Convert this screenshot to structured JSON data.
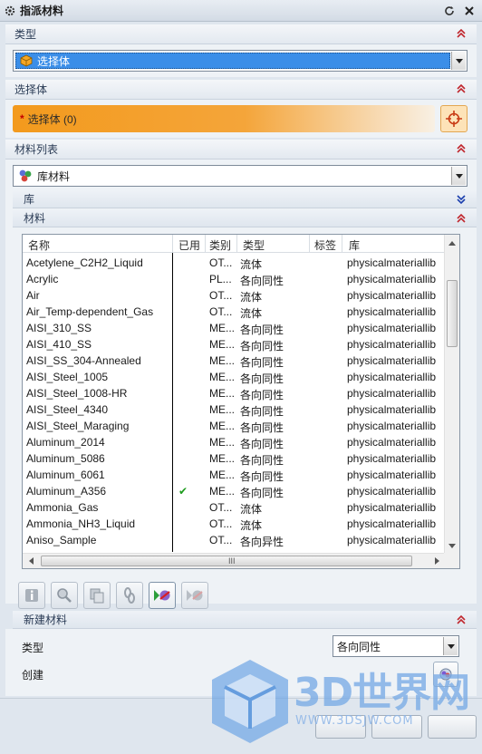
{
  "window": {
    "title": "指派材料"
  },
  "sections": {
    "type": {
      "label": "类型",
      "select_value": "选择体"
    },
    "select_body": {
      "label": "选择体",
      "field_label": "选择体 (0)",
      "required_mark": "*"
    },
    "material_list": {
      "label": "材料列表",
      "select_value": "库材料"
    },
    "library": {
      "label": "库"
    },
    "materials": {
      "label": "材料"
    },
    "new_material": {
      "label": "新建材料",
      "type_label": "类型",
      "type_value": "各向同性",
      "create_label": "创建"
    }
  },
  "table": {
    "columns": [
      "名称",
      "已用",
      "类别",
      "类型",
      "标签",
      "库"
    ],
    "rows": [
      {
        "name": "Acetylene_C2H2_Liquid",
        "used": "",
        "category": "OT...",
        "type": "流体",
        "tag": "",
        "library": "physicalmateriallib"
      },
      {
        "name": "Acrylic",
        "used": "",
        "category": "PL...",
        "type": "各向同性",
        "tag": "",
        "library": "physicalmateriallib"
      },
      {
        "name": "Air",
        "used": "",
        "category": "OT...",
        "type": "流体",
        "tag": "",
        "library": "physicalmateriallib"
      },
      {
        "name": "Air_Temp-dependent_Gas",
        "used": "",
        "category": "OT...",
        "type": "流体",
        "tag": "",
        "library": "physicalmateriallib"
      },
      {
        "name": "AISI_310_SS",
        "used": "",
        "category": "ME...",
        "type": "各向同性",
        "tag": "",
        "library": "physicalmateriallib"
      },
      {
        "name": "AISI_410_SS",
        "used": "",
        "category": "ME...",
        "type": "各向同性",
        "tag": "",
        "library": "physicalmateriallib"
      },
      {
        "name": "AISI_SS_304-Annealed",
        "used": "",
        "category": "ME...",
        "type": "各向同性",
        "tag": "",
        "library": "physicalmateriallib"
      },
      {
        "name": "AISI_Steel_1005",
        "used": "",
        "category": "ME...",
        "type": "各向同性",
        "tag": "",
        "library": "physicalmateriallib"
      },
      {
        "name": "AISI_Steel_1008-HR",
        "used": "",
        "category": "ME...",
        "type": "各向同性",
        "tag": "",
        "library": "physicalmateriallib"
      },
      {
        "name": "AISI_Steel_4340",
        "used": "",
        "category": "ME...",
        "type": "各向同性",
        "tag": "",
        "library": "physicalmateriallib"
      },
      {
        "name": "AISI_Steel_Maraging",
        "used": "",
        "category": "ME...",
        "type": "各向同性",
        "tag": "",
        "library": "physicalmateriallib"
      },
      {
        "name": "Aluminum_2014",
        "used": "",
        "category": "ME...",
        "type": "各向同性",
        "tag": "",
        "library": "physicalmateriallib"
      },
      {
        "name": "Aluminum_5086",
        "used": "",
        "category": "ME...",
        "type": "各向同性",
        "tag": "",
        "library": "physicalmateriallib"
      },
      {
        "name": "Aluminum_6061",
        "used": "",
        "category": "ME...",
        "type": "各向同性",
        "tag": "",
        "library": "physicalmateriallib"
      },
      {
        "name": "Aluminum_A356",
        "used": "✔",
        "category": "ME...",
        "type": "各向同性",
        "tag": "",
        "library": "physicalmateriallib"
      },
      {
        "name": "Ammonia_Gas",
        "used": "",
        "category": "OT...",
        "type": "流体",
        "tag": "",
        "library": "physicalmateriallib"
      },
      {
        "name": "Ammonia_NH3_Liquid",
        "used": "",
        "category": "OT...",
        "type": "流体",
        "tag": "",
        "library": "physicalmateriallib"
      },
      {
        "name": "Aniso_Sample",
        "used": "",
        "category": "OT...",
        "type": "各向异性",
        "tag": "",
        "library": "physicalmateriallib"
      }
    ]
  },
  "scrollbar": {
    "grip": "III"
  },
  "toolbar": {
    "buttons": [
      "info-icon",
      "inspect-icon",
      "copy-icon",
      "link-icon",
      "assign-material-icon",
      "remove-material-icon"
    ]
  },
  "watermark": {
    "brand": "3D世界网",
    "url": "WWW.3DSJW.COM"
  },
  "colors": {
    "accent_orange": "#f39a1d",
    "selection_blue": "#3b8ee8",
    "check_green": "#1d9b1d",
    "section_arrow_red": "#c0262d"
  }
}
